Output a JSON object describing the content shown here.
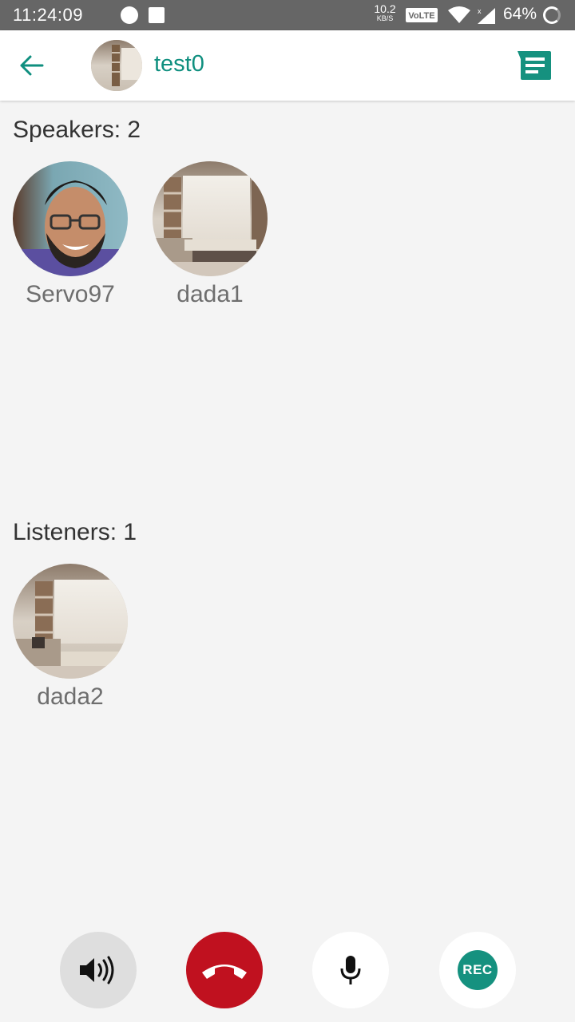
{
  "status_bar": {
    "time": "11:24:09",
    "net_speed_value": "10.2",
    "net_speed_unit": "KB/S",
    "volte": "VoLTE",
    "battery": "64%"
  },
  "header": {
    "title": "test0",
    "back_icon": "arrow-left-icon",
    "chat_icon": "chat-list-icon"
  },
  "speakers": {
    "label": "Speakers: 2",
    "members": [
      {
        "name": "Servo97"
      },
      {
        "name": "dada1"
      }
    ]
  },
  "listeners": {
    "label": "Listeners: 1",
    "members": [
      {
        "name": "dada2"
      }
    ]
  },
  "controls": {
    "rec_label": "REC",
    "speaker_icon": "speaker-volume-icon",
    "hangup_icon": "hang-up-icon",
    "mic_icon": "microphone-icon"
  },
  "colors": {
    "accent": "#0f8f7f",
    "hangup": "#c0111f",
    "status_bar": "#666666",
    "background": "#f4f4f4"
  }
}
